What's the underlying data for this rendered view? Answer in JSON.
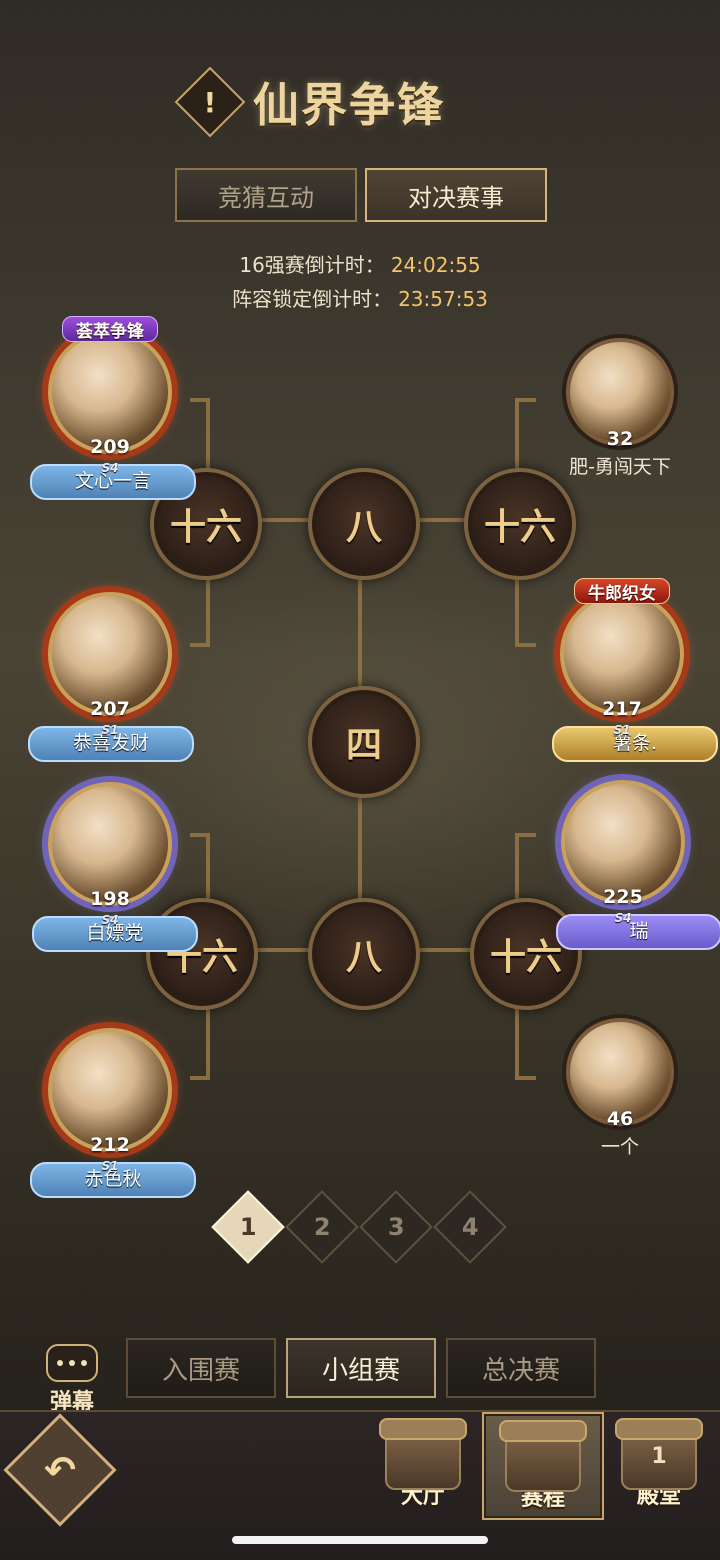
{
  "header": {
    "title": "仙界争锋",
    "icon": "exclamation-diamond-icon"
  },
  "toggle": {
    "left": "竞猜互动",
    "right": "对决赛事",
    "active": "right"
  },
  "countdown": {
    "line1_label": "16强赛倒计时：",
    "line1_value": "24:02:55",
    "line2_label": "阵容锁定倒计时：",
    "line2_value": "23:57:53"
  },
  "bracket_labels": {
    "sixteen": "十六",
    "eight": "八",
    "four": "四"
  },
  "players": {
    "left": [
      {
        "name": "文心一言",
        "level": "209",
        "season": "S4",
        "tag": "荟萃争锋"
      },
      {
        "name": "恭喜发财",
        "level": "207",
        "season": "S1"
      },
      {
        "name": "白嫖党",
        "level": "198",
        "season": "S4"
      },
      {
        "name": "赤色秋",
        "level": "212",
        "season": "S1"
      }
    ],
    "right": [
      {
        "name": "肥-勇闯天下",
        "level": "32"
      },
      {
        "name": "薯条.",
        "level": "217",
        "season": "S1",
        "tag": "牛郎织女"
      },
      {
        "name": "瑞",
        "level": "225",
        "season": "S4"
      },
      {
        "name": "一个",
        "level": "46"
      }
    ]
  },
  "pager": {
    "pages": [
      "1",
      "2",
      "3",
      "4"
    ],
    "active": 0
  },
  "barrage": {
    "label": "弹幕"
  },
  "stages": {
    "tabs": [
      "入围赛",
      "小组赛",
      "总决赛"
    ],
    "active": 1
  },
  "bottom_nav": {
    "items": [
      {
        "label": "大厅"
      },
      {
        "label": "赛程"
      },
      {
        "label": "殿堂",
        "badge": "1"
      }
    ],
    "active": 1
  },
  "colors": {
    "gold": "#f3c46a",
    "frame": "#8e7245"
  }
}
